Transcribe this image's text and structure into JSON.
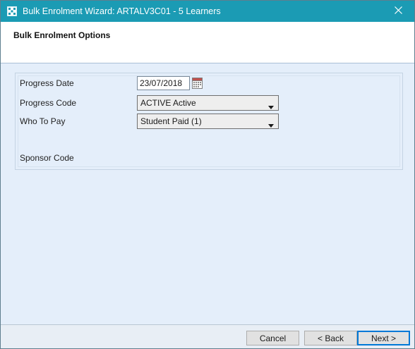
{
  "window": {
    "title": "Bulk Enrolment Wizard: ARTALV3C01 - 5 Learners",
    "title_bar_color": "#1b9bb4",
    "icons": {
      "app": "wizard-app-icon",
      "close": "close-icon"
    }
  },
  "header": {
    "title": "Bulk Enrolment Options"
  },
  "form": {
    "progress_date": {
      "label": "Progress Date",
      "value": "23/07/2018",
      "picker_icon": "calendar-icon"
    },
    "progress_code": {
      "label": "Progress Code",
      "selected": "ACTIVE Active"
    },
    "who_to_pay": {
      "label": "Who To Pay",
      "selected": "Student Paid (1)"
    },
    "sponsor_code": {
      "label": "Sponsor Code"
    }
  },
  "footer": {
    "cancel_label": "Cancel",
    "back_label": "< Back",
    "next_label": "Next >"
  },
  "colors": {
    "panel_background": "#e4eefa",
    "default_button_border": "#0078d7"
  }
}
